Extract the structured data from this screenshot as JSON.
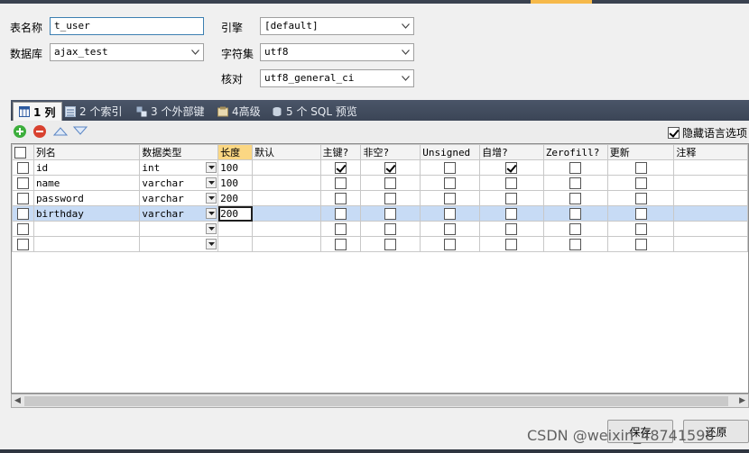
{
  "form": {
    "table_name_label": "表名称",
    "table_name_value": "t_user",
    "database_label": "数据库",
    "database_value": "ajax_test",
    "engine_label": "引擎",
    "engine_value": "[default]",
    "charset_label": "字符集",
    "charset_value": "utf8",
    "collation_label": "核对",
    "collation_value": "utf8_general_ci"
  },
  "tabs": [
    {
      "label": "1 列",
      "icon": "columns-icon"
    },
    {
      "label": "2 个索引",
      "icon": "index-icon"
    },
    {
      "label": "3 个外部键",
      "icon": "foreign-key-icon"
    },
    {
      "label": "4高级",
      "icon": "advanced-icon"
    },
    {
      "label": "5 个 SQL 预览",
      "icon": "sql-preview-icon"
    }
  ],
  "toolbar": {
    "hide_language_label": "隐藏语言选项",
    "hide_language_checked": true
  },
  "grid": {
    "headers": [
      "列名",
      "数据类型",
      "长度",
      "默认",
      "主键?",
      "非空?",
      "Unsigned",
      "自增?",
      "Zerofill?",
      "更新",
      "注释"
    ],
    "rows": [
      {
        "name": "id",
        "type": "int",
        "length": "100",
        "pk": true,
        "notnull": true,
        "unsigned": false,
        "autoinc": true,
        "zerofill": false,
        "update": false
      },
      {
        "name": "name",
        "type": "varchar",
        "length": "100",
        "pk": false,
        "notnull": false,
        "unsigned": false,
        "autoinc": false,
        "zerofill": false,
        "update": false
      },
      {
        "name": "password",
        "type": "varchar",
        "length": "200",
        "pk": false,
        "notnull": false,
        "unsigned": false,
        "autoinc": false,
        "zerofill": false,
        "update": false
      },
      {
        "name": "birthday",
        "type": "varchar",
        "length": "200",
        "pk": false,
        "notnull": false,
        "unsigned": false,
        "autoinc": false,
        "zerofill": false,
        "update": false
      },
      {
        "name": "",
        "type": "",
        "length": "",
        "pk": false,
        "notnull": false,
        "unsigned": false,
        "autoinc": false,
        "zerofill": false,
        "update": false
      },
      {
        "name": "",
        "type": "",
        "length": "",
        "pk": false,
        "notnull": false,
        "unsigned": false,
        "autoinc": false,
        "zerofill": false,
        "update": false
      }
    ],
    "selected_row": 3
  },
  "buttons": {
    "save": "保存",
    "restore": "还原"
  },
  "watermark": "CSDN @weixin_48741598",
  "colors": {
    "tabbar": "#4a5568",
    "current_header": "#fbd783",
    "selected_row": "#c7dbf5"
  }
}
